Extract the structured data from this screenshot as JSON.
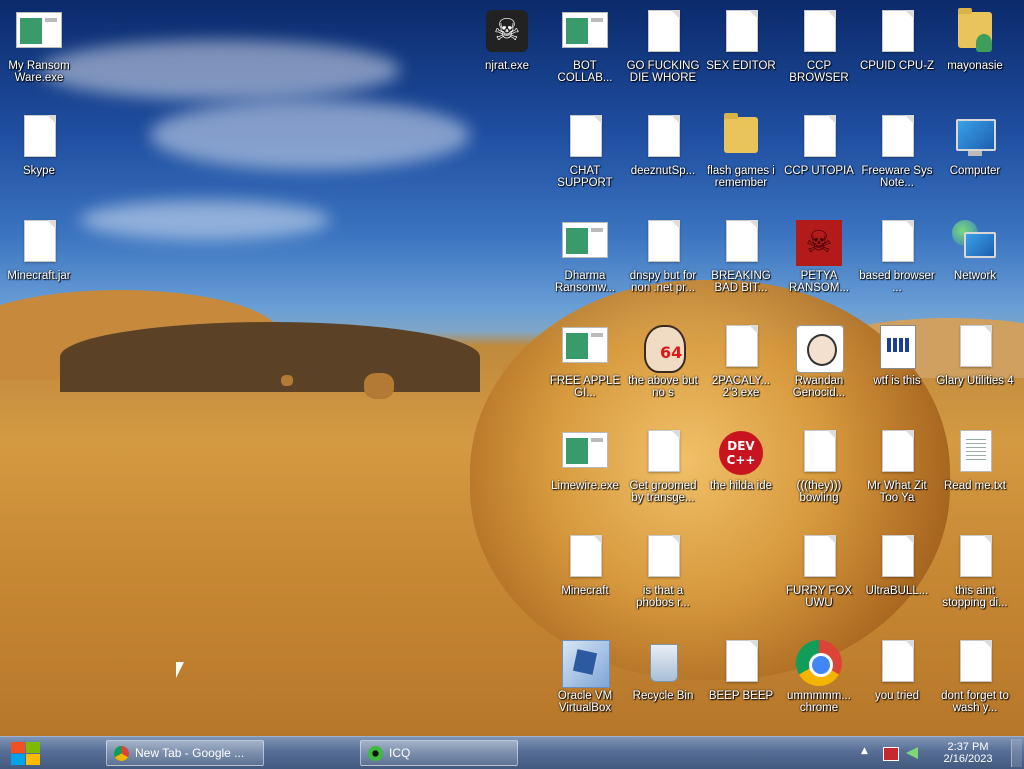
{
  "desktop": {
    "icons": [
      {
        "label": "My Ransom Ware.exe",
        "icon": "exe-icon"
      },
      {
        "label": "Skype",
        "icon": "file-icon"
      },
      {
        "label": "Minecraft.jar",
        "icon": "file-icon"
      },
      {
        "label": "njrat.exe",
        "icon": "skull-icon"
      },
      {
        "label": "BOT COLLAB...",
        "icon": "exe-icon"
      },
      {
        "label": "GO FUCKING DIE WHORE",
        "icon": "file-icon"
      },
      {
        "label": "SEX EDITOR",
        "icon": "file-icon"
      },
      {
        "label": "CCP BROWSER",
        "icon": "file-icon"
      },
      {
        "label": "CPUID CPU-Z",
        "icon": "file-icon"
      },
      {
        "label": "mayonasie",
        "icon": "folder-icon"
      },
      {
        "label": "CHAT SUPPORT",
        "icon": "file-icon"
      },
      {
        "label": "deeznutSp...",
        "icon": "file-icon"
      },
      {
        "label": "flash games i remember",
        "icon": "folder-icon"
      },
      {
        "label": "CCP UTOPIA",
        "icon": "file-icon"
      },
      {
        "label": "Freeware Sys Note...",
        "icon": "file-icon"
      },
      {
        "label": "Computer",
        "icon": "computer-icon"
      },
      {
        "label": "Dharma Ransomw...",
        "icon": "exe-icon"
      },
      {
        "label": "dnspy but for non .net pr...",
        "icon": "file-icon"
      },
      {
        "label": "BREAKING BAD BIT...",
        "icon": "file-icon"
      },
      {
        "label": "PETYA RANSOM...",
        "icon": "petya-icon"
      },
      {
        "label": "based browser ...",
        "icon": "file-icon"
      },
      {
        "label": "Network",
        "icon": "network-icon"
      },
      {
        "label": "FREE APPLE GI...",
        "icon": "exe-icon"
      },
      {
        "label": "the above but no s",
        "icon": "portrait-icon"
      },
      {
        "label": "2PACALY... 2'3.exe",
        "icon": "file-icon"
      },
      {
        "label": "Rwandan Genocid...",
        "icon": "meme-icon"
      },
      {
        "label": "wtf is this",
        "icon": "wtf-icon"
      },
      {
        "label": "Glary Utilities 4",
        "icon": "file-icon"
      },
      {
        "label": "Limewire.exe",
        "icon": "exe-icon"
      },
      {
        "label": "Get groomed by transge...",
        "icon": "file-icon"
      },
      {
        "label": "the hilda ide",
        "icon": "devcpp-icon"
      },
      {
        "label": "(((they))) bowling",
        "icon": "file-icon"
      },
      {
        "label": "Mr What Zit Too Ya",
        "icon": "file-icon"
      },
      {
        "label": "Read me.txt",
        "icon": "txt-icon"
      },
      {
        "label": "Minecraft",
        "icon": "file-icon"
      },
      {
        "label": "is that a phobos r...",
        "icon": "file-icon"
      },
      {
        "label": "FURRY FOX UWU",
        "icon": "file-icon"
      },
      {
        "label": "UltraBULL...",
        "icon": "file-icon"
      },
      {
        "label": "this aint stopping di...",
        "icon": "file-icon"
      },
      {
        "label": "Oracle VM VirtualBox",
        "icon": "virtualbox-icon"
      },
      {
        "label": "Recycle Bin",
        "icon": "recycle-bin-icon"
      },
      {
        "label": "BEEP BEEP",
        "icon": "file-icon"
      },
      {
        "label": "ummmmm... chrome",
        "icon": "chrome-icon"
      },
      {
        "label": "you tried",
        "icon": "file-icon"
      },
      {
        "label": "dont forget to wash y...",
        "icon": "file-icon"
      }
    ],
    "devcpp_text": "DEV C++",
    "portrait_badge": "64"
  },
  "taskbar": {
    "start_icon": "windows-logo-icon",
    "buttons": [
      {
        "label": "New Tab - Google ...",
        "icon": "chrome-icon"
      },
      {
        "label": "ICQ",
        "icon": "icq-icon"
      }
    ],
    "tray": {
      "icons": [
        "show-hidden-icons-chevron",
        "action-center-flag-icon",
        "volume-icon"
      ],
      "chevron": "▲"
    },
    "clock": {
      "time": "2:37 PM",
      "date": "2/16/2023"
    }
  },
  "colors": {
    "taskbar": "#566e95",
    "sky_top": "#0b2a6b",
    "field": "#d49a42"
  }
}
